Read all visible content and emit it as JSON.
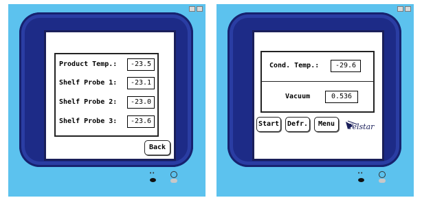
{
  "left_display": {
    "readings": [
      {
        "label": "Product Temp.:",
        "value": "-23.5"
      },
      {
        "label": "Shelf Probe 1:",
        "value": "-23.1"
      },
      {
        "label": "Shelf Probe 2:",
        "value": "-23.0"
      },
      {
        "label": "Shelf Probe 3:",
        "value": "-23.6"
      }
    ],
    "back_label": "Back"
  },
  "right_display": {
    "cond_label": "Cond. Temp.:",
    "cond_value": "-29.6",
    "vacuum_label": "Vacuum",
    "vacuum_value": "0.536",
    "buttons": {
      "start": "Start",
      "defr": "Defr.",
      "menu": "Menu"
    },
    "logo_text": "Telstar"
  },
  "indicators": {
    "led_label": "••"
  },
  "colors": {
    "background": "#5cc2ee",
    "bezel": "#1d2b87",
    "screen": "#ffffff"
  }
}
